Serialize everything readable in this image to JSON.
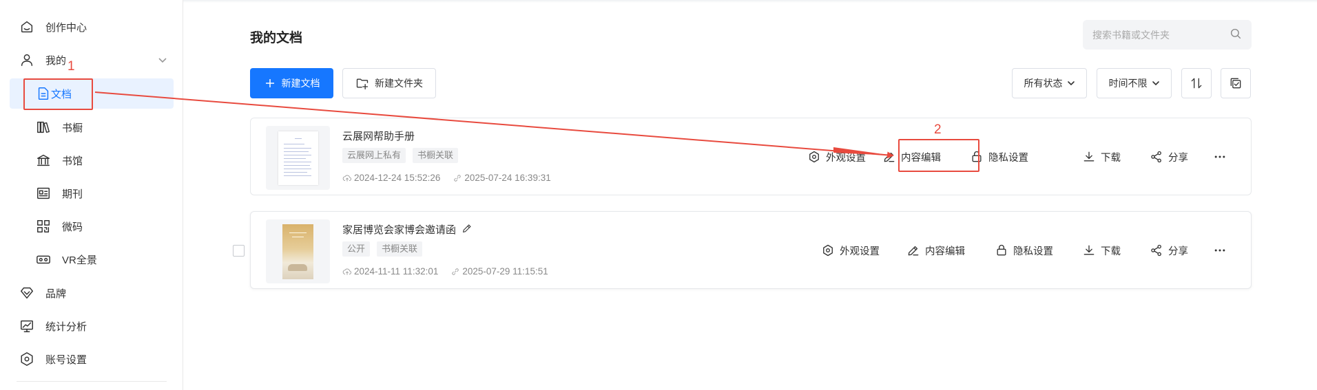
{
  "sidebar": {
    "items": [
      {
        "label": "创作中心",
        "icon": "home-icon"
      },
      {
        "label": "我的",
        "icon": "user-icon"
      },
      {
        "label": "文档",
        "icon": "document-icon"
      },
      {
        "label": "书橱",
        "icon": "bookshelf-icon"
      },
      {
        "label": "书馆",
        "icon": "library-icon"
      },
      {
        "label": "期刊",
        "icon": "journal-icon"
      },
      {
        "label": "微码",
        "icon": "qrcode-icon"
      },
      {
        "label": "VR全景",
        "icon": "vr-icon"
      },
      {
        "label": "品牌",
        "icon": "brand-icon"
      },
      {
        "label": "统计分析",
        "icon": "chart-icon"
      },
      {
        "label": "账号设置",
        "icon": "settings-icon"
      }
    ],
    "active": "文档"
  },
  "header": {
    "title": "我的文档",
    "search_placeholder": "搜索书籍或文件夹"
  },
  "toolbar": {
    "new_doc": "新建文档",
    "new_folder": "新建文件夹",
    "status_filter": "所有状态",
    "time_filter": "时间不限"
  },
  "documents": [
    {
      "title": "云展网帮助手册",
      "tags": [
        "云展网上私有",
        "书橱关联"
      ],
      "created": "2024-12-24 15:52:26",
      "updated": "2025-07-24 16:39:31"
    },
    {
      "title": "家居博览会家博会邀请函",
      "tags": [
        "公开",
        "书橱关联"
      ],
      "created": "2024-11-11 11:32:01",
      "updated": "2025-07-29 11:15:51"
    }
  ],
  "actions": {
    "appearance": "外观设置",
    "content_edit": "内容编辑",
    "privacy": "隐私设置",
    "download": "下载",
    "share": "分享"
  },
  "annotations": {
    "step1": "1",
    "step2": "2",
    "color": "#e84a3e"
  },
  "colors": {
    "primary": "#1677ff",
    "active_bg": "#e9f2ff"
  }
}
